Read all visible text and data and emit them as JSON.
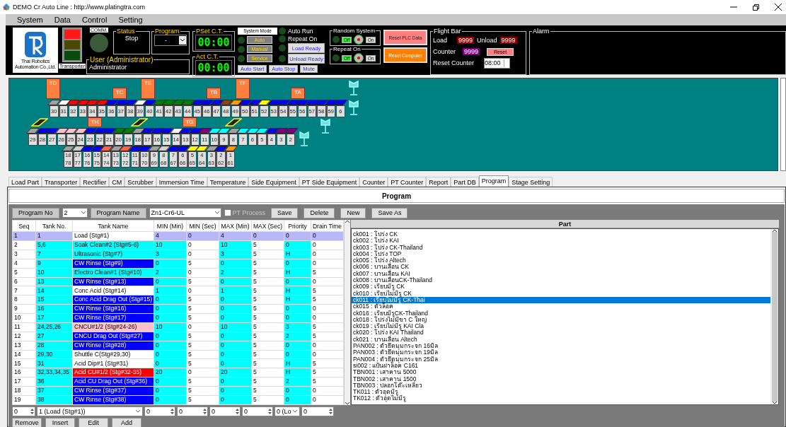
{
  "window": {
    "title": "DEMO Cr Auto Line : http://www.platingtra.com"
  },
  "menu": [
    "System",
    "Data",
    "Control",
    "Setting"
  ],
  "header": {
    "company": "Thai Robotics Automation Co.,Ltd.",
    "tower": {
      "label": "Transporter",
      "lamps": [
        {
          "kind": "red",
          "on": true
        },
        {
          "kind": "yellow",
          "on": false
        },
        {
          "kind": "green",
          "on": false
        }
      ]
    },
    "comm": {
      "label": "COMM.",
      "on": false
    },
    "status": {
      "title": "Status",
      "value": "Stop"
    },
    "program": {
      "title": "Program",
      "value": "-"
    },
    "user": {
      "title": "User (Administrator)",
      "value": "Administrator"
    },
    "pset": {
      "title": "PSet C.T.",
      "value": "00:00"
    },
    "act": {
      "title": "Act C.T.",
      "value": "00:00"
    },
    "system_mode": {
      "title": "System Mode",
      "modes": [
        {
          "label": "Auto",
          "on": false
        },
        {
          "label": "Manual",
          "on": false
        },
        {
          "label": "Service",
          "on": false
        }
      ]
    },
    "commands": [
      "Auto Start",
      "Auto Stop",
      "Mute"
    ],
    "indicators": [
      {
        "kind": "lamp",
        "label": "Auto Run",
        "on": false
      },
      {
        "kind": "lamp",
        "label": "Repeat On",
        "on": false
      },
      {
        "kind": "button",
        "label": "Load Ready",
        "on": false
      },
      {
        "kind": "button",
        "label": "Unload Ready",
        "on": false
      }
    ],
    "switches": [
      {
        "title": "Random System",
        "off_label": "Off",
        "on_label": "On",
        "on": false
      },
      {
        "title": "Repeat On",
        "off_label": "Off",
        "on_label": "On",
        "on": false
      }
    ],
    "reset_buttons": [
      {
        "kind": "plc",
        "label": "Reset PLC Data"
      },
      {
        "kind": "computer",
        "label": "Reset Computer"
      }
    ],
    "flight_bar": {
      "title": "Flight Bar",
      "load_label": "Load",
      "load": "9999",
      "unload_label": "Unload",
      "unload": "9999",
      "counter_label": "Counter",
      "counter": "9999",
      "reset": "Reset",
      "reset_counter_label": "Reset Counter",
      "reset_counter": "08:00"
    },
    "alarm": {
      "title": "Alarm"
    }
  },
  "line": {
    "transporters": [
      "TD",
      "TE",
      "TF",
      "TC",
      "TB",
      "TA",
      "TH",
      "TG"
    ],
    "back_row": [
      {
        "label": "30",
        "color": "#a0a0a0"
      },
      {
        "label": "31",
        "color": "#ffffff"
      },
      {
        "label": "32",
        "color": "#ff0000"
      },
      {
        "label": "33",
        "color": "#ff0000"
      },
      {
        "label": "34",
        "color": "#ff0000"
      },
      {
        "label": "35",
        "color": "#ff0000"
      },
      {
        "label": "36",
        "color": "#0000ff"
      },
      {
        "label": "37",
        "color": "#0000ff"
      },
      {
        "label": "38",
        "color": "#0000ff"
      },
      {
        "label": "39",
        "color": "#ffffff"
      },
      {
        "label": "40",
        "color": "#0000ff"
      },
      {
        "label": "41",
        "color": "#008000"
      },
      {
        "label": "42",
        "color": "#008000"
      },
      {
        "label": "43",
        "color": "#008000"
      },
      {
        "label": "44",
        "color": "#008000"
      },
      {
        "label": "45",
        "color": "#0000ff"
      },
      {
        "label": "46",
        "color": "#0000ff"
      },
      {
        "label": "47",
        "color": "#0000ff"
      },
      {
        "label": "48",
        "color": "#8b4513"
      },
      {
        "label": "49",
        "color": "#ff9900"
      },
      {
        "label": "50",
        "color": "#0000ff"
      },
      {
        "label": "51",
        "color": "#0000ff"
      },
      {
        "label": "52",
        "color": "#ffff00"
      },
      {
        "label": "53",
        "color": "#0000ff"
      },
      {
        "label": "54",
        "color": "#0000ff"
      },
      {
        "label": "55",
        "color": "#0000ff"
      },
      {
        "label": "56",
        "color": "#0000ff"
      },
      {
        "label": "57",
        "color": "#0000ff"
      },
      {
        "label": "58",
        "color": "#0000ff"
      },
      {
        "label": "59",
        "color": "#0000ff"
      },
      {
        "label": "6",
        "color": "#0000ff"
      }
    ],
    "middle_row": [
      {
        "label": "29",
        "color": "#a0a0a0"
      },
      {
        "label": "28",
        "color": "#0000ff"
      },
      {
        "label": "27",
        "color": "#0000ff"
      },
      {
        "label": "26",
        "color": "#ffc0cb"
      },
      {
        "label": "25",
        "color": "#ffc0cb"
      },
      {
        "label": "24",
        "color": "#ffc0cb"
      },
      {
        "label": "23",
        "color": "#0000ff"
      },
      {
        "label": "22",
        "color": "#0000ff"
      },
      {
        "label": "21",
        "color": "#0000ff"
      },
      {
        "label": "20",
        "color": "#008000"
      },
      {
        "label": "19",
        "color": "#008000"
      },
      {
        "label": "18",
        "color": "#a0a0a0"
      },
      {
        "label": "17",
        "color": "#0000ff"
      },
      {
        "label": "16",
        "color": "#0000ff"
      },
      {
        "label": "15",
        "color": "#0000ff"
      },
      {
        "label": "14",
        "color": "#ffffff"
      },
      {
        "label": "13",
        "color": "#0000ff"
      },
      {
        "label": "12",
        "color": "#0000ff"
      },
      {
        "label": "11",
        "color": "#800080"
      },
      {
        "label": "10",
        "color": "#00ffff"
      },
      {
        "label": "9",
        "color": "#00ffff"
      },
      {
        "label": "8",
        "color": "#a0a0a0"
      },
      {
        "label": "7",
        "color": "#00ffff"
      },
      {
        "label": "6",
        "color": "#00ffff"
      },
      {
        "label": "5",
        "color": "#00ffff"
      },
      {
        "label": "4",
        "color": "#0000ff"
      },
      {
        "label": "3",
        "color": "#800080"
      },
      {
        "label": "2",
        "color": "#800080"
      }
    ],
    "front_row": [
      {
        "label": "18",
        "label_2": "78",
        "color": "#a0a0a0"
      },
      {
        "label": "17",
        "label_2": "77",
        "color": "#d0d0d0"
      },
      {
        "label": "16",
        "label_2": "76",
        "color": "#0000ff"
      },
      {
        "label": "15",
        "label_2": "75",
        "color": "#0000ff"
      },
      {
        "label": "14",
        "label_2": "74",
        "color": "#ff6347"
      },
      {
        "label": "13",
        "label_2": "73",
        "color": "#a0a0a0"
      },
      {
        "label": "12",
        "label_2": "72",
        "color": "#ff6347"
      },
      {
        "label": "11",
        "label_2": "71",
        "color": "#0000ff"
      },
      {
        "label": "10",
        "label_2": "70",
        "color": "#0000ff"
      },
      {
        "label": "9",
        "label_2": "69",
        "color": "#a0a0a0"
      },
      {
        "label": "8",
        "label_2": "68",
        "color": "#d0d0d0"
      },
      {
        "label": "7",
        "label_2": "67",
        "color": "#0000ff"
      },
      {
        "label": "6",
        "label_2": "66",
        "color": "#0000ff"
      },
      {
        "label": "5",
        "label_2": "65",
        "color": "#ffff00"
      },
      {
        "label": "4",
        "label_2": "64",
        "color": "#ffff00"
      },
      {
        "label": "3",
        "label_2": "63",
        "color": "#a0a0a0"
      },
      {
        "label": "2",
        "label_2": "62",
        "color": "#0000ff"
      },
      {
        "label": "1",
        "label_2": "61",
        "color": "#ff9900"
      }
    ]
  },
  "tabs": [
    {
      "label": "Load Part",
      "selected": false
    },
    {
      "label": "Transporter",
      "selected": false
    },
    {
      "label": "Rectifier",
      "selected": false
    },
    {
      "label": "CM",
      "selected": false
    },
    {
      "label": "Scrubber",
      "selected": false
    },
    {
      "label": "Immersion Time",
      "selected": false
    },
    {
      "label": "Temperature",
      "selected": false
    },
    {
      "label": "Side Equipment",
      "selected": false
    },
    {
      "label": "PT Side Equipment",
      "selected": false
    },
    {
      "label": "Counter",
      "selected": false
    },
    {
      "label": "PT Counter",
      "selected": false
    },
    {
      "label": "Report",
      "selected": false
    },
    {
      "label": "Part DB",
      "selected": false
    },
    {
      "label": "Program",
      "selected": true
    },
    {
      "label": "Stage Setting",
      "selected": false
    }
  ],
  "program": {
    "title": "Program",
    "program_no_label": "Program No",
    "program_no": "2",
    "program_name_label": "Program Name",
    "program_name": "Zn1-Cr6-UL",
    "pt_process": {
      "label": "PT Process",
      "checked": false
    },
    "actions": [
      "Save",
      "Delete",
      "New",
      "Save As"
    ],
    "table": {
      "columns": [
        "Seq",
        "Tank No.",
        "Tank Name",
        "MIN (Min)",
        "MIN (Sec)",
        "MAX (Min)",
        "MAX (Sec)",
        "Priority",
        "Drain Time"
      ],
      "rows": [
        {
          "selected": true,
          "color": "#ffffff",
          "cells": [
            "1",
            "1",
            "Load (Stg#1)",
            "4",
            "0",
            "4",
            "0",
            "0",
            "0"
          ]
        },
        {
          "selected": false,
          "color": "#00ffff",
          "cells": [
            "2",
            "5,6",
            "Soak Clean#2 (Stg#5-6)",
            "10",
            "0",
            "10",
            "5",
            "0",
            "0"
          ]
        },
        {
          "selected": false,
          "color": "#00ffff",
          "cells": [
            "3",
            "7",
            "Ultrasonic (Stg#7)",
            "3",
            "0",
            "3",
            "5",
            "H",
            "0"
          ]
        },
        {
          "selected": false,
          "color": "#0000ff",
          "cells": [
            "4",
            "9",
            "CW Rinse (Stg#9)",
            "0",
            "5",
            "0",
            "5",
            "0",
            "0"
          ]
        },
        {
          "selected": false,
          "color": "#00ffff",
          "cells": [
            "5",
            "10",
            "Electro Clean#1 (Stg#10)",
            "2",
            "0",
            "2",
            "5",
            "H",
            "5"
          ]
        },
        {
          "selected": false,
          "color": "#0000ff",
          "cells": [
            "6",
            "13",
            "CW Rinse (Stg#13)",
            "0",
            "5",
            "0",
            "5",
            "0",
            "0"
          ]
        },
        {
          "selected": false,
          "color": "#ffffff",
          "cells": [
            "7",
            "14",
            "Conc Acid (Stg#14)",
            "1",
            "0",
            "1",
            "5",
            "H",
            "5"
          ]
        },
        {
          "selected": false,
          "color": "#0000ff",
          "cells": [
            "8",
            "15",
            "Conc Acid Drag Out (Stg#15)",
            "0",
            "5",
            "0",
            "5",
            "H",
            "5"
          ]
        },
        {
          "selected": false,
          "color": "#0000ff",
          "cells": [
            "9",
            "16",
            "CW Rinse (Stg#16)",
            "0",
            "5",
            "0",
            "5",
            "0",
            "0"
          ]
        },
        {
          "selected": false,
          "color": "#0000ff",
          "cells": [
            "10",
            "17",
            "CW Rinse (Stg#17)",
            "0",
            "5",
            "0",
            "5",
            "0",
            "0"
          ]
        },
        {
          "selected": false,
          "color": "#ffc0cb",
          "cells": [
            "11",
            "24,25,26",
            "CNCU#1/2 (Stg#24-26)",
            "10",
            "0",
            "10",
            "5",
            "3",
            "5"
          ]
        },
        {
          "selected": false,
          "color": "#0000ff",
          "cells": [
            "12",
            "27",
            "CNCU Drag Out (Stg#27)",
            "0",
            "5",
            "0",
            "5",
            "2",
            "5"
          ]
        },
        {
          "selected": false,
          "color": "#0000ff",
          "cells": [
            "13",
            "28",
            "CW Rinse (Stg#28)",
            "0",
            "5",
            "0",
            "5",
            "0",
            "0"
          ]
        },
        {
          "selected": false,
          "color": "#ffffff",
          "cells": [
            "14",
            "29,30",
            "Shuttle C(Stg#29,30)",
            "0",
            "5",
            "0",
            "5",
            "0",
            "0"
          ]
        },
        {
          "selected": false,
          "color": "#ffffff",
          "cells": [
            "15",
            "31",
            "Acid Dip#1 (Stg#31)",
            "0",
            "5",
            "0",
            "5",
            "H",
            "5"
          ]
        },
        {
          "selected": false,
          "color": "#ff0000",
          "cells": [
            "16",
            "32,33,34,35",
            "Acid CU#1/2 (Stg#32-35)",
            "20",
            "0",
            "20",
            "5",
            "H",
            "5"
          ]
        },
        {
          "selected": false,
          "color": "#0000ff",
          "cells": [
            "17",
            "36",
            "Acid CU Drag Out (Stg#36)",
            "0",
            "5",
            "0",
            "5",
            "2",
            "5"
          ]
        },
        {
          "selected": false,
          "color": "#0000ff",
          "cells": [
            "18",
            "37",
            "CW Rinse (Stg#37)",
            "0",
            "5",
            "0",
            "5",
            "0",
            "0"
          ]
        },
        {
          "selected": false,
          "color": "#0000ff",
          "cells": [
            "19",
            "38",
            "CW Rinse (Stg#38)",
            "0",
            "5",
            "0",
            "5",
            "0",
            "0"
          ]
        }
      ]
    },
    "editor": [
      {
        "kind": "spin",
        "value": "0"
      },
      {
        "kind": "select",
        "value": "1 (Load (Stg#1))"
      },
      {
        "kind": "spin",
        "value": "0"
      },
      {
        "kind": "spin",
        "value": "0"
      },
      {
        "kind": "spin",
        "value": "0"
      },
      {
        "kind": "spin",
        "value": "0"
      },
      {
        "kind": "select",
        "value": "0 (Lo"
      },
      {
        "kind": "spin",
        "value": "0"
      }
    ],
    "row_actions": [
      "Remove",
      "Insert",
      "Edit",
      "Add"
    ]
  },
  "parts": {
    "title": "Part",
    "items": [
      {
        "text": "ck001 : โปร่ง CK",
        "selected": false
      },
      {
        "text": "ck002 : โปร่ง KAI",
        "selected": false
      },
      {
        "text": "ck003 : โปร่ง CK-Thailand",
        "selected": false
      },
      {
        "text": "ck004 : โปร่ง TOP",
        "selected": false
      },
      {
        "text": "ck005 : โปร่ง Altech",
        "selected": false
      },
      {
        "text": "ck006 : บานเลื่อน CK",
        "selected": false
      },
      {
        "text": "ck007 : บานเลื่อน KAI",
        "selected": false
      },
      {
        "text": "ck008 : บานเลื่อนCK-Thailand",
        "selected": false
      },
      {
        "text": "ck009 : เรียบมีรู CK",
        "selected": false
      },
      {
        "text": "ck010 : เรียบไม่มีรู CK",
        "selected": false
      },
      {
        "text": "ck011 : เรียบไม่มีรู CK-Thai",
        "selected": true
      },
      {
        "text": "ck015 : ตัวล็อค",
        "selected": false
      },
      {
        "text": "ck016 : เรียบมีรูCK-Thailand",
        "selected": false
      },
      {
        "text": "ck018 : โปร่งไม่มีขา C ใหญ่",
        "selected": false
      },
      {
        "text": "ck019 : เรียบไม่มีรู KAI Cla",
        "selected": false
      },
      {
        "text": "ck020 : โปร่ง KAI Thailand",
        "selected": false
      },
      {
        "text": "ck021 : บานเลื่อน Altech",
        "selected": false
      },
      {
        "text": "PAN002 : ตัวยึดมุมกระจก 16มิล",
        "selected": false
      },
      {
        "text": "PAN003 : ตัวยึดมุมกระจก 19มิล",
        "selected": false
      },
      {
        "text": "PAN004 : ตัวยึดมุมกระจก 25มิล",
        "selected": false
      },
      {
        "text": "si002 : แป้นฝาล็อค C161",
        "selected": false
      },
      {
        "text": "TBN001 : เสาคาน 5000",
        "selected": false
      },
      {
        "text": "TBN002 : เสาคาน 1500",
        "selected": false
      },
      {
        "text": "TBN003 : ปลอกโต๊ะเหลี่ยว",
        "selected": false
      },
      {
        "text": "TK011 : ตัวอุดมีรู",
        "selected": false
      },
      {
        "text": "TK012 : ตัวอุดไม่มีรู",
        "selected": false
      }
    ]
  }
}
